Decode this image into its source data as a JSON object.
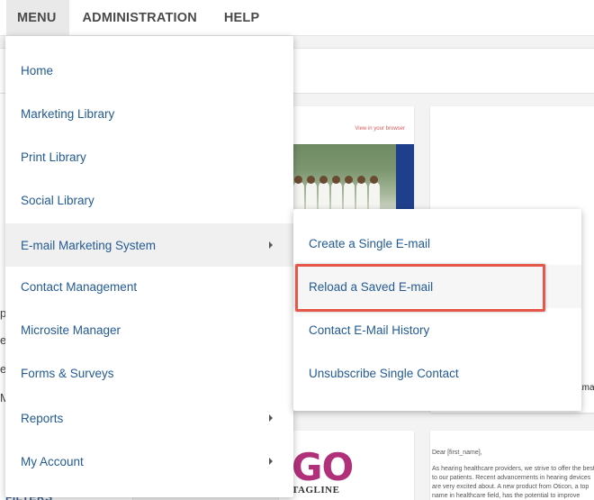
{
  "topnav": {
    "menu_label": "MENU",
    "administration_label": "ADMINISTRATION",
    "help_label": "HELP"
  },
  "menu": {
    "items": [
      {
        "label": "Home",
        "has_submenu": false
      },
      {
        "label": "Marketing Library",
        "has_submenu": false
      },
      {
        "label": "Print Library",
        "has_submenu": false
      },
      {
        "label": "Social Library",
        "has_submenu": false
      },
      {
        "label": "E-mail Marketing System",
        "has_submenu": true
      },
      {
        "label": "Contact Management",
        "has_submenu": false
      },
      {
        "label": "Microsite Manager",
        "has_submenu": false
      },
      {
        "label": "Forms & Surveys",
        "has_submenu": false
      },
      {
        "label": "Reports",
        "has_submenu": true
      },
      {
        "label": "My Account",
        "has_submenu": true
      }
    ],
    "active_item": "E-mail Marketing System"
  },
  "submenu": {
    "items": [
      {
        "label": "Create a Single E-mail"
      },
      {
        "label": "Reload a Saved E-mail"
      },
      {
        "label": "Contact E-Mail History"
      },
      {
        "label": "Unsubscribe Single Contact"
      }
    ],
    "highlighted_item": "Reload a Saved E-mail"
  },
  "background": {
    "email_preview": {
      "view_in_browser": "View in your browser"
    },
    "logo_text": "GO",
    "logo_tagline": "TAGLINE",
    "letter": {
      "salutation": "Dear [first_name],",
      "body": "As hearing healthcare providers, we strive to offer the best to our patients. Recent advancements in hearing devices are very excited about. A new product from Oticon, a top name in healthcare field, has the potential to improve communicat"
    },
    "fragments": {
      "left_1": "p",
      "left_2": "e",
      "left_3": "e",
      "left_4": "M",
      "right_ema": "Ema",
      "filters": "FILTERS"
    }
  },
  "colors": {
    "link_blue": "#245b93",
    "highlight_red": "#e5574a",
    "nav_active_bg": "#e9e9e9",
    "logo_magenta": "#b0307a"
  }
}
